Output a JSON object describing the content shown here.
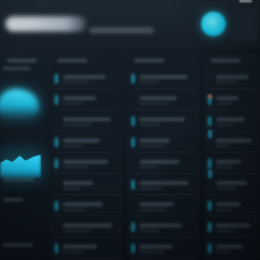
{
  "header": {
    "title": "",
    "subtitle": ""
  },
  "panels": [
    {
      "id": "left-chart-panel",
      "rows": 4
    },
    {
      "id": "list-panel-1",
      "rows": 9
    },
    {
      "id": "list-panel-2",
      "rows": 9
    },
    {
      "id": "list-panel-3",
      "rows": 9
    }
  ],
  "colors": {
    "background": "#0b1118",
    "panel": "#141d26",
    "accent": "#1fc8ec",
    "accent_glow": "#46e6ff",
    "muted_text": "#3b4955",
    "warning": "#c8643a"
  },
  "icons": {
    "avatar": "user-avatar-icon"
  }
}
